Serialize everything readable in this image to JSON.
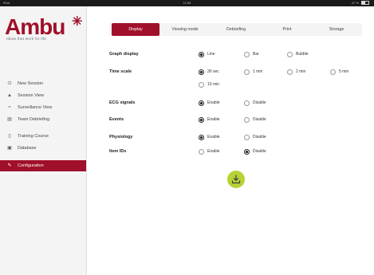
{
  "statusbar": {
    "carrier": "iPad",
    "time": "11:55",
    "battery": "47 %"
  },
  "brand": {
    "name": "Ambu",
    "tagline": "Ideas that work for life"
  },
  "nav": {
    "items": [
      {
        "label": "New Session",
        "icon": "power-icon"
      },
      {
        "label": "Session View",
        "icon": "person-icon"
      },
      {
        "label": "Surveillance View",
        "icon": "surveillance-icon"
      },
      {
        "label": "Team Debriefing",
        "icon": "debrief-icon"
      },
      {
        "label": "Training Course",
        "icon": "course-icon"
      },
      {
        "label": "Database",
        "icon": "database-icon"
      },
      {
        "label": "Configuration",
        "icon": "wrench-icon",
        "active": true
      }
    ]
  },
  "tabs": [
    {
      "label": "Display",
      "active": true
    },
    {
      "label": "Viewing mode"
    },
    {
      "label": "Debriefing"
    },
    {
      "label": "Print"
    },
    {
      "label": "Storage"
    }
  ],
  "settings": {
    "graph_display": {
      "label": "Graph display",
      "options": [
        "Line",
        "Bar",
        "Bubble"
      ],
      "selected": "Line"
    },
    "time_scale": {
      "label": "Time scale",
      "options": [
        "30 sec",
        "1 min",
        "2 min",
        "5 min",
        "10 min"
      ],
      "selected": "30 sec"
    },
    "ecg_signals": {
      "label": "ECG signals",
      "options": [
        "Enable",
        "Disable"
      ],
      "selected": "Enable"
    },
    "events": {
      "label": "Events",
      "options": [
        "Enable",
        "Disable"
      ],
      "selected": "Enable"
    },
    "physiology": {
      "label": "Physiology",
      "options": [
        "Enable",
        "Disable"
      ],
      "selected": "Enable"
    },
    "item_ids": {
      "label": "Item IDs",
      "options": [
        "Enable",
        "Disable"
      ],
      "selected": "Disable"
    }
  },
  "colors": {
    "accent": "#a0102a",
    "save_button": "#b5d334"
  }
}
